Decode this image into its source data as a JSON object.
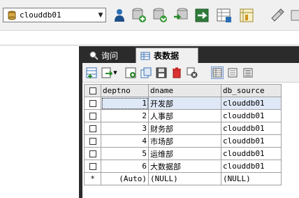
{
  "toolbar": {
    "database": "clouddb01",
    "icons": [
      "user-icon",
      "backup-icon",
      "restore-icon",
      "import-icon",
      "export-icon",
      "schema-icon",
      "query-builder-icon",
      "tools-icon"
    ]
  },
  "tabs": [
    {
      "label": "询问",
      "icon": "query-icon"
    },
    {
      "label": "表数据",
      "icon": "table-icon"
    }
  ],
  "grid": {
    "columns": [
      "deptno",
      "dname",
      "db_source"
    ],
    "rows": [
      {
        "deptno": "1",
        "dname": "开发部",
        "db_source": "clouddb01"
      },
      {
        "deptno": "2",
        "dname": "人事部",
        "db_source": "clouddb01"
      },
      {
        "deptno": "3",
        "dname": "财务部",
        "db_source": "clouddb01"
      },
      {
        "deptno": "4",
        "dname": "市场部",
        "db_source": "clouddb01"
      },
      {
        "deptno": "5",
        "dname": "运维部",
        "db_source": "clouddb01"
      },
      {
        "deptno": "6",
        "dname": "大数据部",
        "db_source": "clouddb01"
      }
    ],
    "new_row": {
      "marker": "*",
      "deptno": "(Auto)",
      "dname": "(NULL)",
      "db_source": "(NULL)"
    }
  },
  "colors": {
    "accent": "#2b2b2b",
    "selected_row": "#dfe8f6"
  }
}
